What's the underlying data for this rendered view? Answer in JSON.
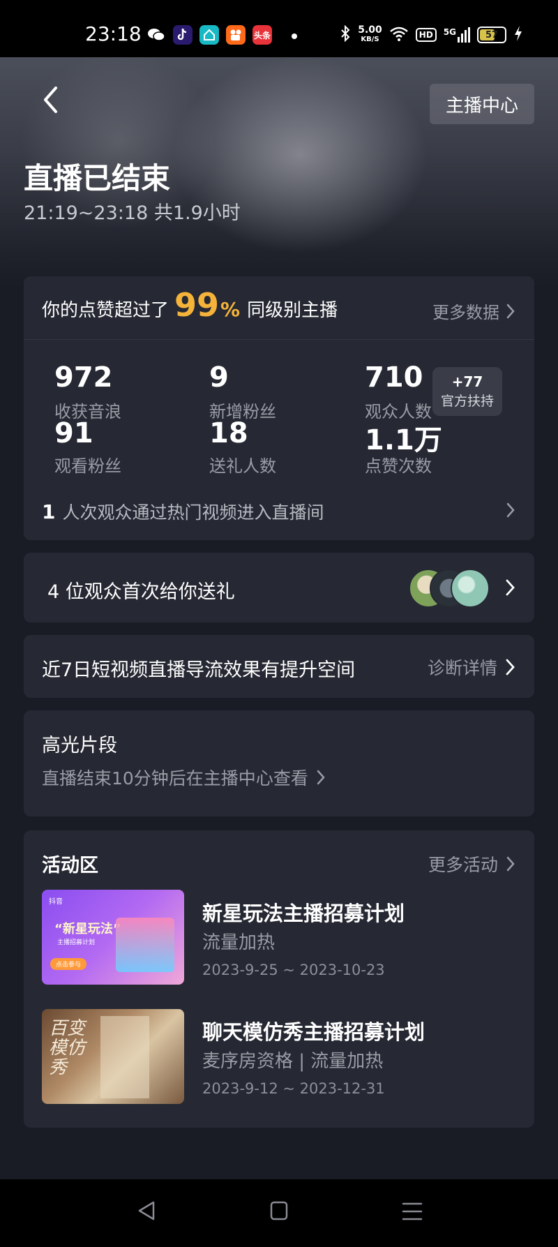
{
  "status_bar": {
    "time": "23:18",
    "apps": [
      "wechat-icon",
      "douyin-icon",
      "home-app-icon",
      "kuaishou-icon",
      "toutiao-icon"
    ],
    "toutiao_label": "头条",
    "speed_value": "5.00",
    "speed_unit": "KB/S",
    "hd_label": "HD",
    "network_label": "5G",
    "battery": "57"
  },
  "header": {
    "anchor_center_button": "主播中心",
    "title": "直播已结束",
    "subtitle": "21:19~23:18 共1.9小时"
  },
  "stats_card": {
    "rank_prefix": "你的点赞超过了",
    "rank_value": "99",
    "rank_sign": "%",
    "rank_suffix": "同级别主播",
    "more_data": "更多数据",
    "stats": [
      {
        "value": "972",
        "label": "收获音浪"
      },
      {
        "value": "9",
        "label": "新增粉丝"
      },
      {
        "value": "710",
        "label": "观众人数"
      },
      {
        "value": "91",
        "label": "观看粉丝"
      },
      {
        "value": "18",
        "label": "送礼人数"
      },
      {
        "value": "1.1万",
        "label": "点赞次数"
      }
    ],
    "support_badge": {
      "value": "+77",
      "label": "官方扶持"
    },
    "hot_count": "1",
    "hot_text": "人次观众通过热门视频进入直播间"
  },
  "gift_row": {
    "text": "4 位观众首次给你送礼"
  },
  "diagnosis_row": {
    "text": "近7日短视频直播导流效果有提升空间",
    "link": "诊断详情"
  },
  "highlights": {
    "title": "高光片段",
    "text": "直播结束10分钟后在主播中心查看"
  },
  "activities": {
    "title": "活动区",
    "more": "更多活动",
    "items": [
      {
        "title": "新星玩法主播招募计划",
        "tags": "流量加热",
        "date": "2023-9-25 ~ 2023-10-23",
        "thumb_brand": "抖音",
        "thumb_title": "“新星玩法”",
        "thumb_sub": "主播招募计划",
        "thumb_btn": "点击参与"
      },
      {
        "title": "聊天模仿秀主播招募计划",
        "tags": "麦序房资格 | 流量加热",
        "date": "2023-9-12 ~ 2023-12-31",
        "thumb_calligraphy": "百变模仿秀"
      }
    ]
  },
  "colors": {
    "accent": "#f5b33a",
    "card_bg": "#262933",
    "page_bg": "#1a1c25"
  }
}
